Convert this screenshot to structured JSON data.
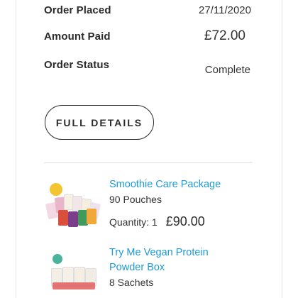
{
  "summary": {
    "order_placed_label": "Order Placed",
    "order_placed_value": "27/11/2020",
    "amount_paid_label": "Amount Paid",
    "amount_paid_value": "£72.00",
    "order_status_label": "Order Status",
    "order_status_value": "Complete"
  },
  "actions": {
    "full_details_label": "FULL DETAILS"
  },
  "items": [
    {
      "title": "Smoothie Care Package",
      "subtitle": "90 Pouches",
      "quantity_label": "Quantity: 1",
      "price": "£90.00",
      "thumbnail_icon": "smoothie-pouches-image"
    },
    {
      "title_line1": "Try Me Vegan Protein",
      "title_line2": "Powder Box",
      "subtitle": "8 Sachets",
      "thumbnail_icon": "protein-sachets-image"
    }
  ],
  "colors": {
    "link": "#1e9ad6",
    "text": "#2b2b2b",
    "divider": "#e0e0e0"
  }
}
